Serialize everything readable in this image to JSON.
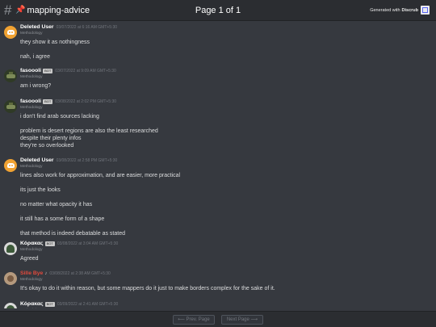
{
  "header": {
    "hash_icon": "#",
    "pin_icon": "📌",
    "channel": "mapping-advice",
    "page_info": "Page 1 of 1",
    "generated_prefix": "Generated with",
    "generated_brand": "Discrub"
  },
  "messages": [
    {
      "author": "Deleted User",
      "badge": "",
      "note": "",
      "timestamp": "03/07/2022 at 6:16 AM GMT+5:30",
      "role": "Methodology",
      "avatar": "discord-default",
      "lines": [
        "they show it as nothingness",
        "nah, i agree"
      ]
    },
    {
      "author": "fasoooli",
      "badge": "BOT",
      "note": "",
      "timestamp": "03/07/2022 at 9:09 AM GMT+5:30",
      "role": "Methodology",
      "avatar": "tank",
      "lines": [
        "am i wrong?"
      ]
    },
    {
      "author": "fasoooli",
      "badge": "BOT",
      "note": "",
      "timestamp": "03/08/2022 at 2:02 PM GMT+5:30",
      "role": "Methodology",
      "avatar": "tank",
      "lines": [
        "i don't find arab sources lacking",
        "problem is desert regions are also the least researched",
        "despite their plenty infos",
        "they're so overlooked"
      ]
    },
    {
      "author": "Deleted User",
      "badge": "",
      "note": "",
      "timestamp": "03/08/2022 at 2:58 PM GMT+5:30",
      "role": "Methodology",
      "avatar": "discord-default",
      "lines": [
        "lines also work for approximation, and are easier, more practical",
        "its just the looks",
        "no matter what opacity it has",
        "it still has a some form of a shape",
        "that method is indeed debatable as stated"
      ]
    },
    {
      "author": "Κόρακας",
      "badge": "BOT",
      "note": "",
      "timestamp": "03/08/2022 at 3:04 AM GMT+5:30",
      "role": "Methodology",
      "avatar": "helmet",
      "lines": [
        "Agreed"
      ]
    },
    {
      "author": "Sille Bye",
      "badge": "",
      "note": "♪",
      "timestamp": "03/08/2022 at 2:38 AM GMT+5:30",
      "role": "Methodology",
      "avatar": "cat",
      "lines": [
        "It's okay to do it within reason, but some mappers do it just to make borders complex for the sake of it."
      ]
    },
    {
      "author": "Κόρακας",
      "badge": "BOT",
      "note": "",
      "timestamp": "03/09/2022 at 2:41 AM GMT+5:30",
      "role": "Methodology",
      "avatar": "helmet",
      "lines": []
    }
  ],
  "footer": {
    "prev_label": "⟵ Prev. Page",
    "next_label": "Next Page ⟶"
  }
}
